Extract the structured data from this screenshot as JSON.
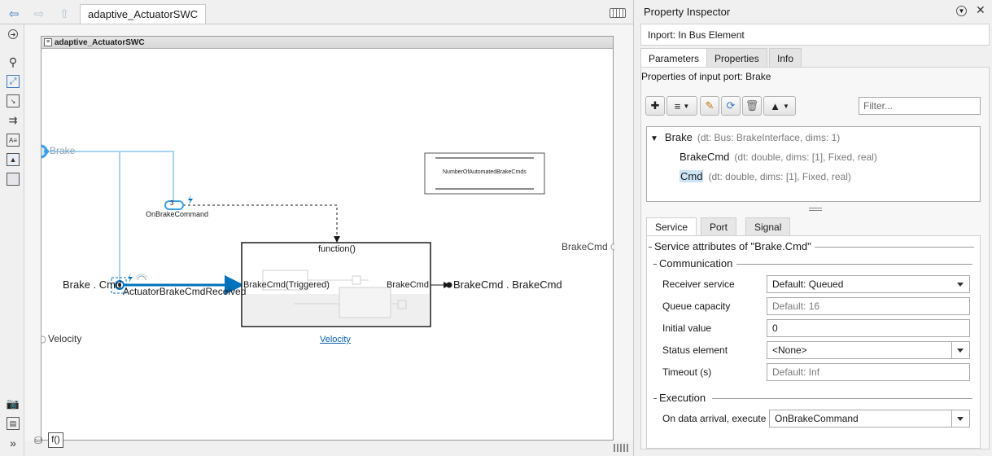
{
  "editor": {
    "tab_label": "adaptive_ActuatorSWC",
    "model_window_title": "adaptive_ActuatorSWC",
    "toolbar": {
      "back_icon": "arrow-left-icon",
      "forward_icon": "arrow-right-icon",
      "up_icon": "arrow-up-icon",
      "keyboard_icon": "keyboard-icon"
    },
    "palette_icons": [
      "hide-show-icon",
      "zoom-in-icon",
      "fit-to-view-icon",
      "zoom-region-icon",
      "signal-icon",
      "annotation-icon",
      "image-icon",
      "area-icon",
      "camera-icon",
      "data-inspector-icon",
      "expand-icon"
    ],
    "bottom_buttons": [
      "database-icon",
      "f()"
    ],
    "diagram": {
      "inport_brake": "Brake",
      "bus_element_in": "Brake . Cmd",
      "event_label": "ActuatorBrakeCmdReceived",
      "trigger_port_number": "3",
      "trigger_port_label": "OnBrakeCommand",
      "function_block_title": "function()",
      "function_in_port": "BrakeCmd(Triggered)",
      "function_out_port": "BrakeCmd",
      "bus_element_out": "BrakeCmd . BrakeCmd",
      "outport_brakecmd": "BrakeCmd",
      "inport_velocity": "Velocity",
      "velocity_link": "Velocity",
      "annotation_text": "NumberOfAutomatedBrakeCmds"
    }
  },
  "inspector": {
    "title": "Property Inspector",
    "subtitle": "Inport: In Bus Element",
    "tabs": [
      "Parameters",
      "Properties",
      "Info"
    ],
    "active_tab": "Parameters",
    "properties_label": "Properties of input port: Brake",
    "toolbar_icons": [
      "add-bus-element-icon",
      "add-to-list-icon",
      "edit-pencil-icon",
      "refresh-icon",
      "delete-icon",
      "highlight-icon"
    ],
    "filter_placeholder": "Filter...",
    "tree": [
      {
        "name": "Brake",
        "dt": "(dt: Bus: BrakeInterface, dims: 1)",
        "expanded": true
      },
      {
        "name": "BrakeCmd",
        "dt": "(dt: double, dims: [1], Fixed, real)"
      },
      {
        "name": "Cmd",
        "dt": "(dt: double, dims: [1], Fixed, real)",
        "selected": true
      }
    ],
    "sub_tabs": [
      "Service",
      "Port",
      "Signal"
    ],
    "active_sub_tab": "Service",
    "service_title": "Service attributes of \"Brake.Cmd\"",
    "communication": {
      "title": "Communication",
      "receiver_service_label": "Receiver service",
      "receiver_service_value": "Default: Queued",
      "queue_capacity_label": "Queue capacity",
      "queue_capacity_placeholder": "Default: 16",
      "initial_value_label": "Initial value",
      "initial_value_value": "0",
      "status_element_label": "Status element",
      "status_element_value": "<None>",
      "timeout_label": "Timeout (s)",
      "timeout_placeholder": "Default: Inf"
    },
    "execution": {
      "title": "Execution",
      "on_data_arrival_label": "On data arrival, execute",
      "on_data_arrival_value": "OnBrakeCommand"
    },
    "accent_color": "#0072bd",
    "selection_color": "#cce4f7"
  }
}
